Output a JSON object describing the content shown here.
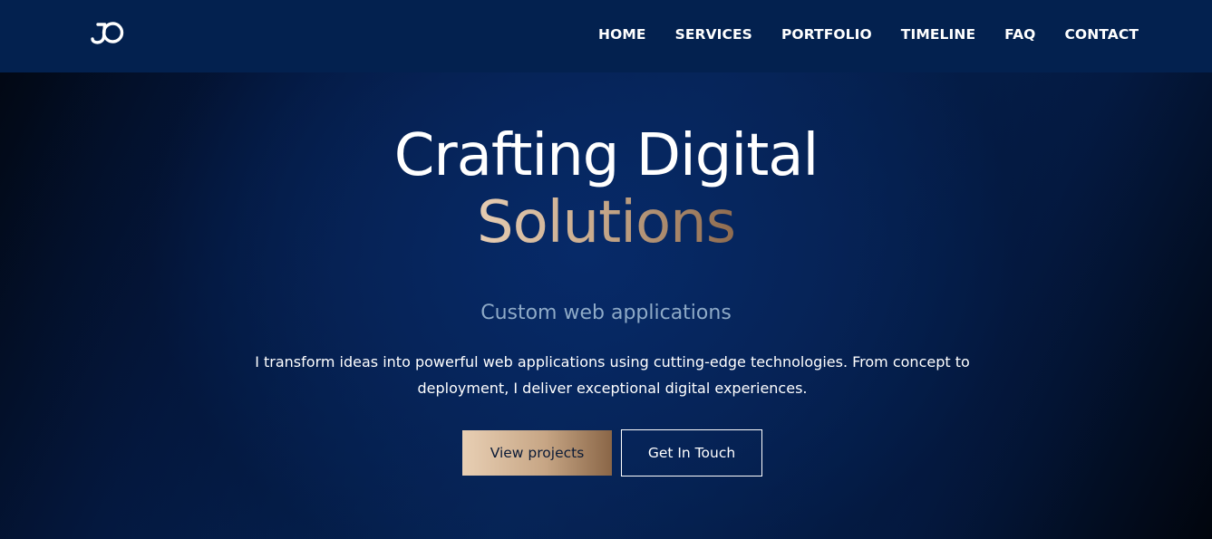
{
  "brand": {
    "logo_icon": "jo-monogram-logo",
    "color": "#ffffff"
  },
  "nav": {
    "items": [
      {
        "label": "HOME"
      },
      {
        "label": "SERVICES"
      },
      {
        "label": "PORTFOLIO"
      },
      {
        "label": "TIMELINE"
      },
      {
        "label": "FAQ"
      },
      {
        "label": "CONTACT"
      }
    ],
    "background": "#03214f"
  },
  "hero": {
    "headline_line1": "Crafting Digital",
    "headline_line2": "Solutions",
    "subtitle": "Custom web applications",
    "description": "I transform ideas into powerful web applications using cutting-edge technologies. From concept to deployment, I deliver exceptional digital experiences.",
    "primary_button": "View projects",
    "secondary_button": "Get In Touch",
    "accent_gradient": [
      "#e6cdb3",
      "#8e6b4f"
    ],
    "subtitle_color": "#8eaac7"
  }
}
